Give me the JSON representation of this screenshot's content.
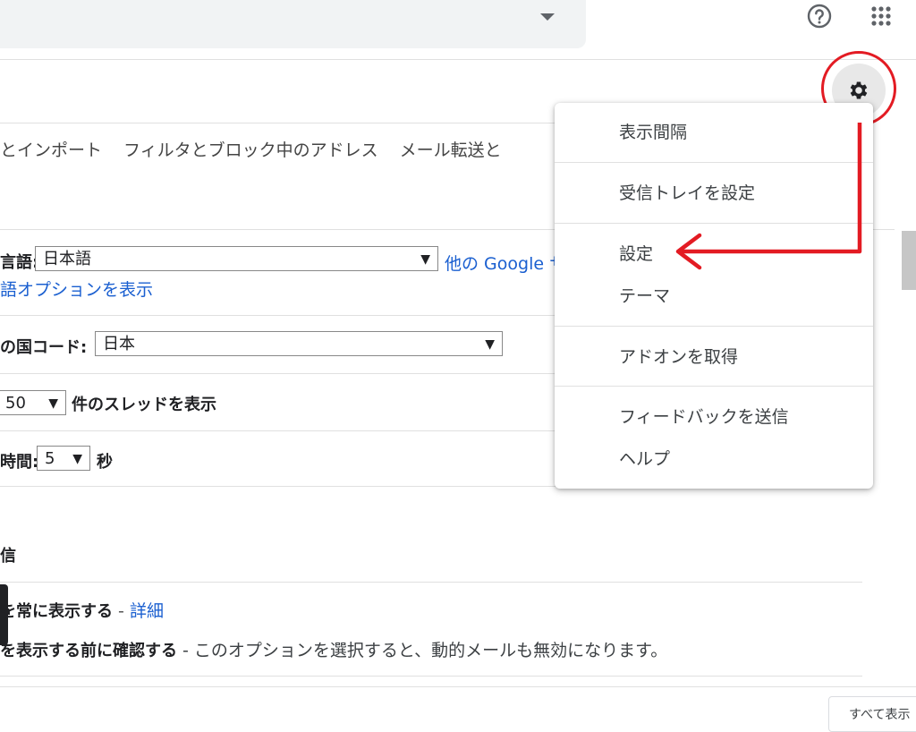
{
  "header": {
    "help_icon": "help-circle-icon",
    "apps_icon": "apps-grid-icon"
  },
  "tabs": [
    "とインポート",
    "フィルタとブロック中のアドレス",
    "メール転送と"
  ],
  "settings": {
    "language_label": "言語:",
    "language_value": "日本語",
    "language_link": "他の Google サ",
    "language_options_link": "語オプションを表示",
    "country_label": "の国コード:",
    "country_value": "日本",
    "threads_value": "50",
    "threads_label": "件のスレッドを表示",
    "undo_label": "時間:",
    "undo_value": "5",
    "undo_unit": "秒",
    "section_heading": "信",
    "always_show_label": "を常に表示する",
    "dash": " - ",
    "details_link": "詳細",
    "confirm_label": "を表示する前に確認する",
    "confirm_desc": " - このオプションを選択すると、動的メールも無効になります。",
    "arrow_glyph": "▼"
  },
  "menu": {
    "items": [
      "表示間隔",
      "受信トレイを設定",
      "設定",
      "テーマ",
      "アドオンを取得",
      "フィードバックを送信",
      "ヘルプ"
    ]
  },
  "gear_icon": "gear-icon",
  "bottom_button": "すべて表示",
  "colors": {
    "annotation_red": "#e31b23",
    "link_blue": "#1a5fd0"
  }
}
